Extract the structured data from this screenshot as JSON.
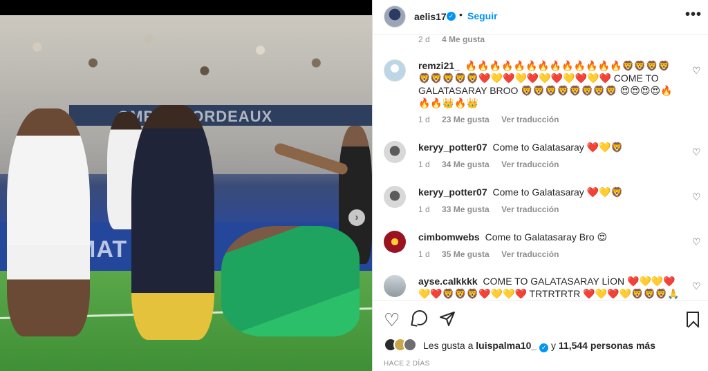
{
  "post": {
    "author": "aelis17",
    "follow_label": "Seguir",
    "dot": "•",
    "more_label": "•••",
    "photo_board_text": "OMPTE BORDEAUX",
    "photo_ad_text": "MAT IN E"
  },
  "stub_comment": {
    "time": "2 d",
    "likes": "4 Me gusta"
  },
  "comments": [
    {
      "user": "remzi21_",
      "text": "🔥🔥🔥🔥🔥🔥🔥🔥🔥🔥🔥🔥🔥🦁🦁🦁🦁🦁🦁🦁🦁🦁❤️💛❤️💛❤️💛❤️💛❤️💛❤️ COME TO GALATASARAY BROO 🦁🦁🦁🦁🦁🦁🦁🦁 😍😍😍😍🔥🔥🔥👑🔥👑",
      "time": "1 d",
      "likes": "23 Me gusta",
      "translate": "Ver traducción"
    },
    {
      "user": "keryy_potter07",
      "text": "Come to Galatasaray ❤️💛🦁",
      "time": "1 d",
      "likes": "34 Me gusta",
      "translate": "Ver traducción"
    },
    {
      "user": "keryy_potter07",
      "text": "Come to Galatasaray ❤️💛🦁",
      "time": "1 d",
      "likes": "33 Me gusta",
      "translate": "Ver traducción"
    },
    {
      "user": "cimbomwebs",
      "text": "Come to Galatasaray Bro 😍",
      "time": "1 d",
      "likes": "35 Me gusta",
      "translate": "Ver traducción"
    },
    {
      "user": "ayse.calkkkk",
      "text": "COME TO GALATASARAY LİON ❤️💛💛❤️💛❤️🦁🦁🦁❤️💛💛❤️ TRTRTRTR ❤️💛❤️💛🦁🦁🦁🙏🙏🙏",
      "time": "",
      "likes": "",
      "translate": ""
    }
  ],
  "likes_summary": {
    "prefix": "Les gusta a",
    "liker": "luispalma10_",
    "middle": "y",
    "count": "11,544 personas más"
  },
  "date": "HACE 2 DÍAS",
  "icons": {
    "heart": "heart-icon",
    "comment": "comment-icon",
    "share": "share-icon",
    "save": "bookmark-icon",
    "verified": "verified-badge-icon",
    "more": "more-options-icon",
    "next": "chevron-right-icon"
  },
  "colors": {
    "accent": "#0095f6",
    "text": "#262626",
    "muted": "#8e8e8e"
  }
}
